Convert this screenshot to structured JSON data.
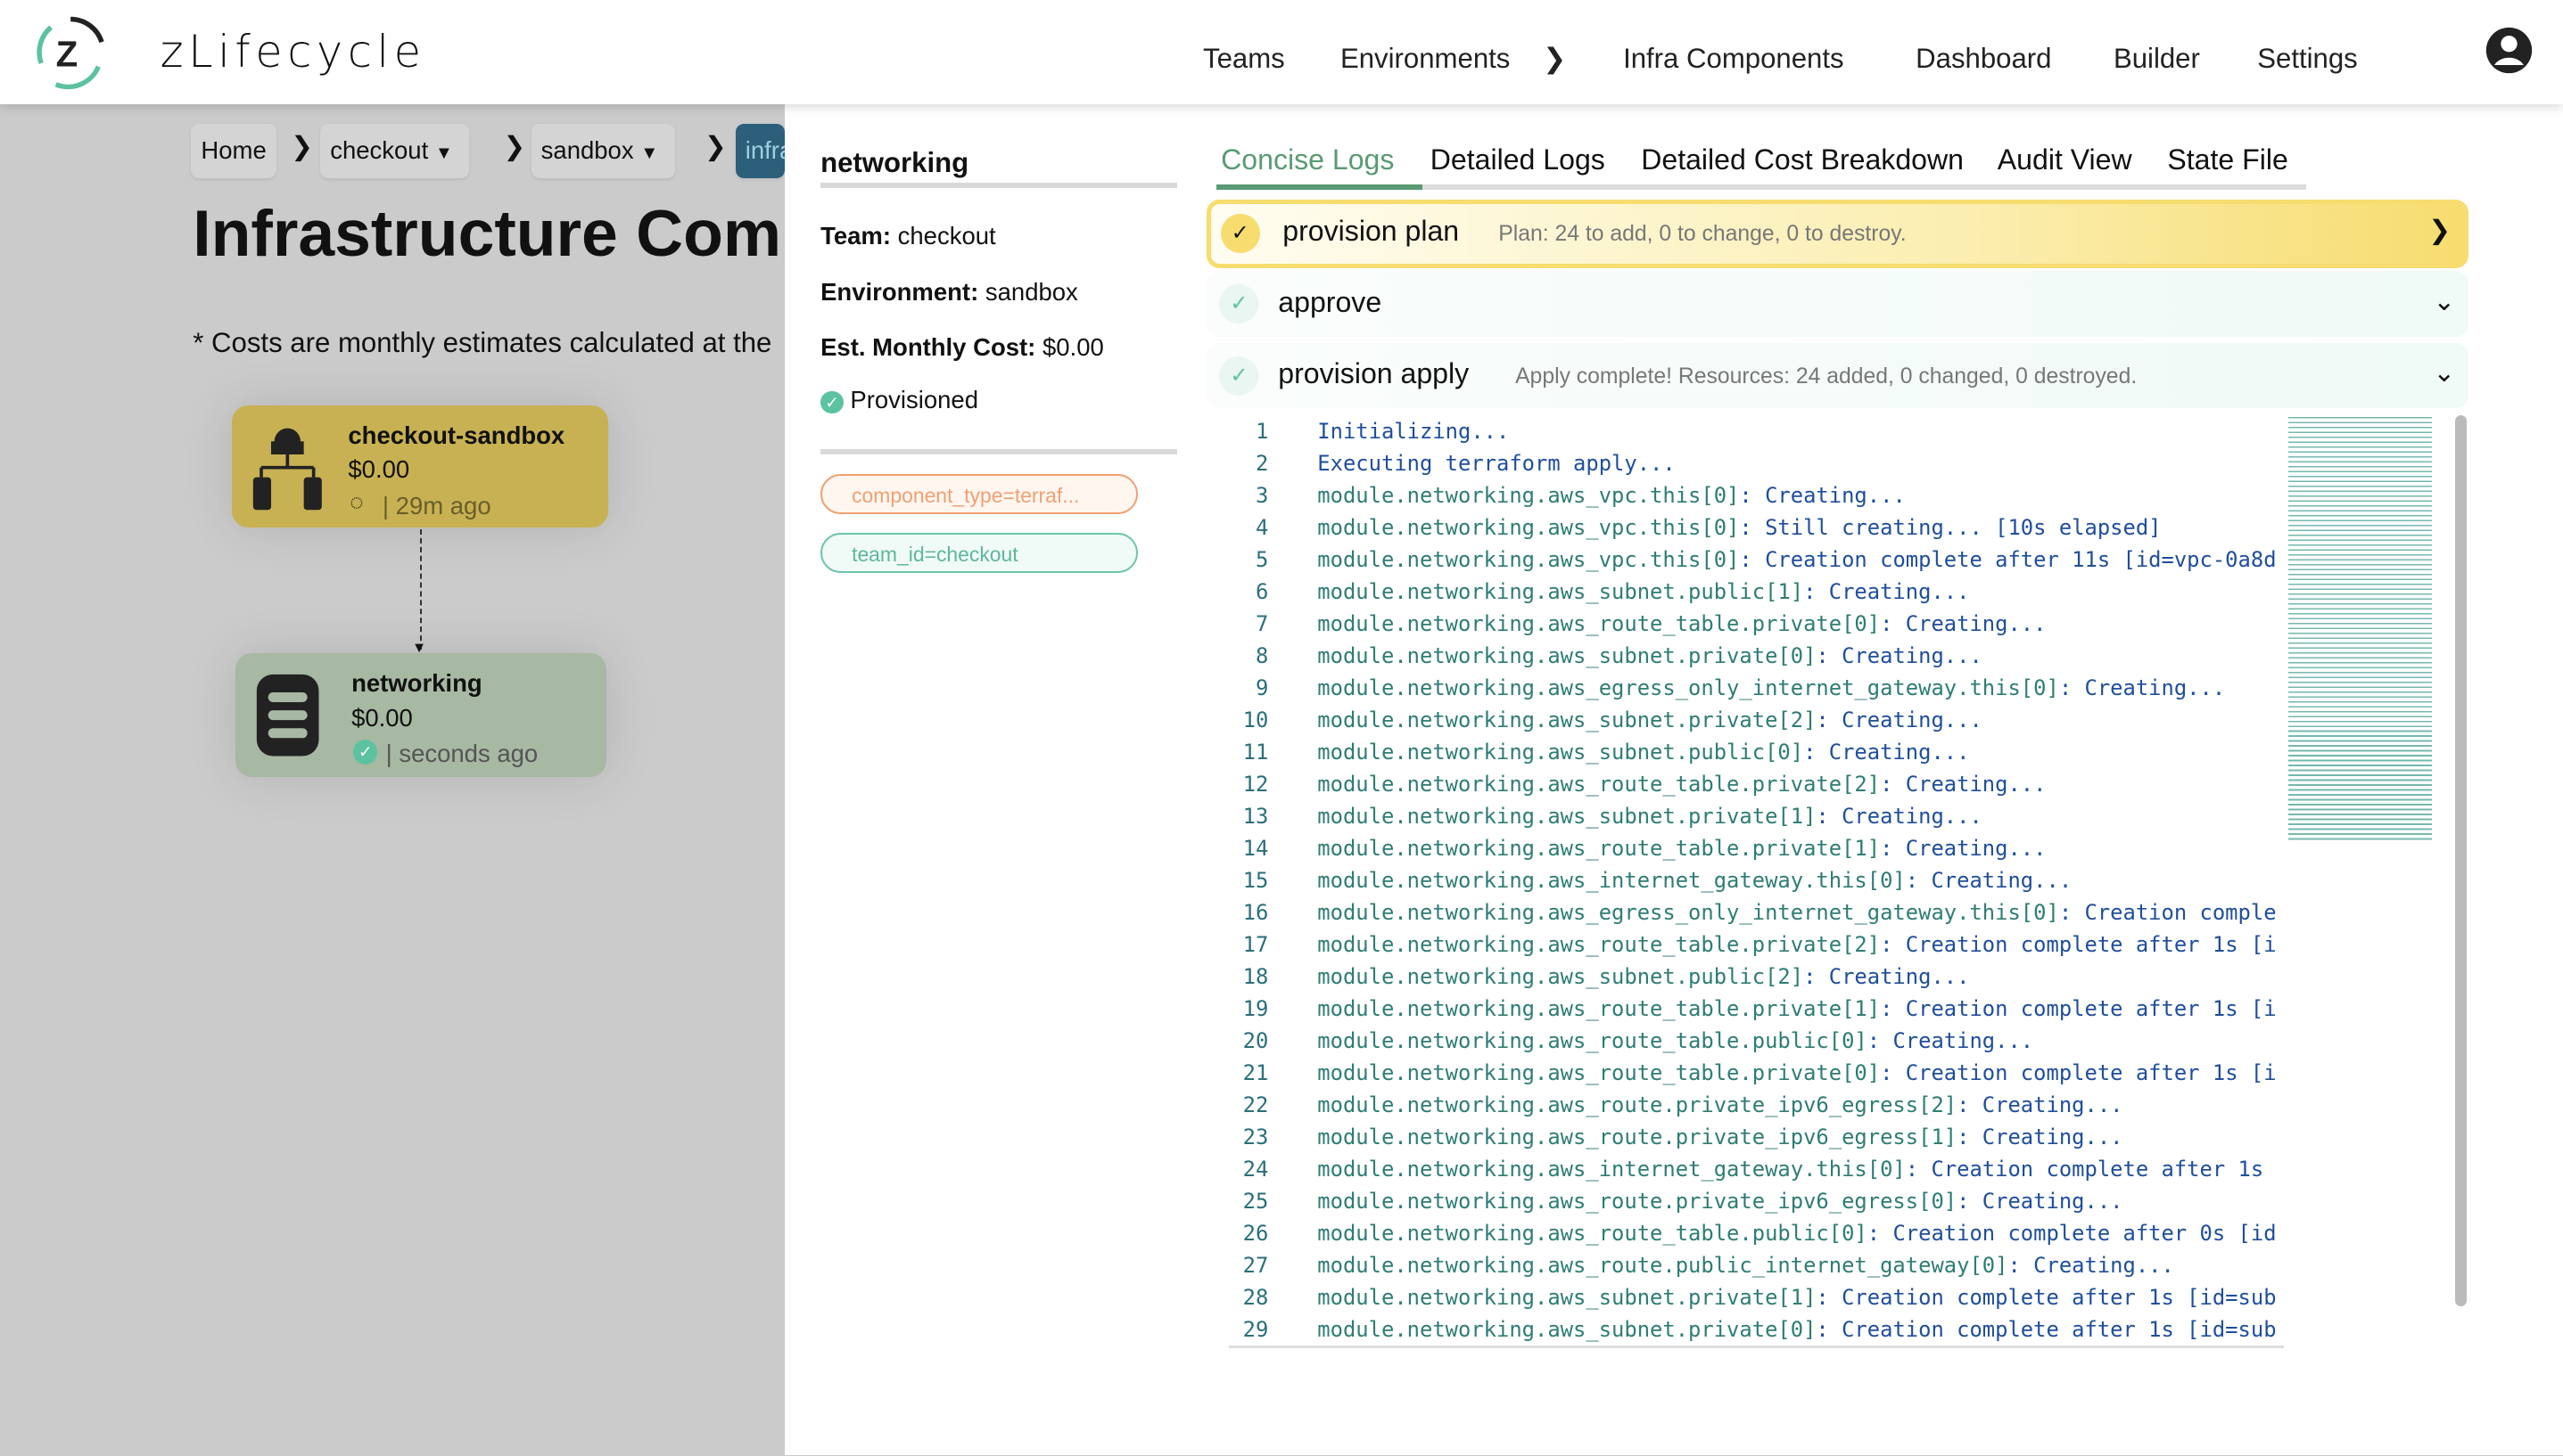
{
  "header": {
    "brand": "zLifecycle",
    "nav": [
      "Teams",
      "Environments",
      "Infra Components",
      "Dashboard",
      "Builder",
      "Settings"
    ]
  },
  "breadcrumb": {
    "home": "Home",
    "team": "checkout",
    "env": "sandbox",
    "current": "infra"
  },
  "page": {
    "title": "Infrastructure Comp",
    "note": "* Costs are monthly estimates calculated at the"
  },
  "nodes": [
    {
      "name": "checkout-sandbox",
      "cost": "$0.00",
      "time": "| 29m ago",
      "status": "in-progress",
      "color": "#c8b152"
    },
    {
      "name": "networking",
      "cost": "$0.00",
      "time": "| seconds ago",
      "status": "provisioned",
      "color": "#a7b8a3"
    }
  ],
  "panel": {
    "title": "networking",
    "team_label": "Team:",
    "team": "checkout",
    "env_label": "Environment:",
    "env": "sandbox",
    "cost_label": "Est. Monthly Cost:",
    "cost": "$0.00",
    "status": "Provisioned",
    "tags": [
      "component_type=terraf...",
      "team_id=checkout"
    ],
    "tabs": [
      "Concise Logs",
      "Detailed Logs",
      "Detailed Cost Breakdown",
      "Audit View",
      "State File"
    ],
    "active_tab": "Concise Logs",
    "steps": [
      {
        "title": "provision plan",
        "summary": "Plan: 24 to add, 0 to change, 0 to destroy."
      },
      {
        "title": "approve",
        "summary": ""
      },
      {
        "title": "provision apply",
        "summary": "Apply complete! Resources: 24 added, 0 changed, 0 destroyed."
      }
    ],
    "logs": [
      [
        "",
        "Initializing..."
      ],
      [
        "",
        "Executing terraform apply..."
      ],
      [
        "module.networking.aws_vpc.this[0]",
        ": Creating..."
      ],
      [
        "module.networking.aws_vpc.this[0]",
        ": Still creating... [10s elapsed]"
      ],
      [
        "module.networking.aws_vpc.this[0]",
        ": Creation complete after 11s [id=vpc-0a8d"
      ],
      [
        "module.networking.aws_subnet.public[1]",
        ": Creating..."
      ],
      [
        "module.networking.aws_route_table.private[0]",
        ": Creating..."
      ],
      [
        "module.networking.aws_subnet.private[0]",
        ": Creating..."
      ],
      [
        "module.networking.aws_egress_only_internet_gateway.this[0]",
        ": Creating..."
      ],
      [
        "module.networking.aws_subnet.private[2]",
        ": Creating..."
      ],
      [
        "module.networking.aws_subnet.public[0]",
        ": Creating..."
      ],
      [
        "module.networking.aws_route_table.private[2]",
        ": Creating..."
      ],
      [
        "module.networking.aws_subnet.private[1]",
        ": Creating..."
      ],
      [
        "module.networking.aws_route_table.private[1]",
        ": Creating..."
      ],
      [
        "module.networking.aws_internet_gateway.this[0]",
        ": Creating..."
      ],
      [
        "module.networking.aws_egress_only_internet_gateway.this[0]",
        ": Creation comple"
      ],
      [
        "module.networking.aws_route_table.private[2]",
        ": Creation complete after 1s [i"
      ],
      [
        "module.networking.aws_subnet.public[2]",
        ": Creating..."
      ],
      [
        "module.networking.aws_route_table.private[1]",
        ": Creation complete after 1s [i"
      ],
      [
        "module.networking.aws_route_table.public[0]",
        ": Creating..."
      ],
      [
        "module.networking.aws_route_table.private[0]",
        ": Creation complete after 1s [i"
      ],
      [
        "module.networking.aws_route.private_ipv6_egress[2]",
        ": Creating..."
      ],
      [
        "module.networking.aws_route.private_ipv6_egress[1]",
        ": Creating..."
      ],
      [
        "module.networking.aws_internet_gateway.this[0]",
        ": Creation complete after 1s"
      ],
      [
        "module.networking.aws_route.private_ipv6_egress[0]",
        ": Creating..."
      ],
      [
        "module.networking.aws_route_table.public[0]",
        ": Creation complete after 0s [id"
      ],
      [
        "module.networking.aws_route.public_internet_gateway[0]",
        ": Creating..."
      ],
      [
        "module.networking.aws_subnet.private[1]",
        ": Creation complete after 1s [id=sub"
      ],
      [
        "module.networking.aws_subnet.private[0]",
        ": Creation complete after 1s [id=sub"
      ]
    ]
  },
  "colors": {
    "accent": "#5a9a74",
    "plan": "#f7dc6f",
    "teal": "#5cc2a0",
    "crumb_active": "#2b5f7a"
  }
}
